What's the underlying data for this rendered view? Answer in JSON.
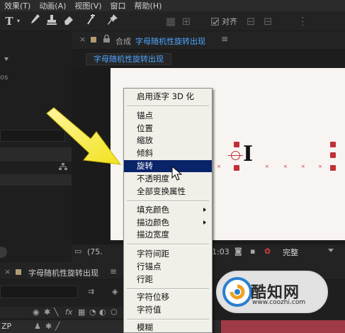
{
  "menubar": {
    "items": [
      "效果(T)",
      "动画(A)",
      "视图(V)",
      "窗口",
      "帮助(H)"
    ]
  },
  "toolbar": {
    "snap_label": "对齐"
  },
  "left_panel": {
    "partial_text": "os"
  },
  "comp_panel": {
    "kind_label": "合成",
    "comp_name": "字母随机性旋转出现",
    "tab_label": "字母随机性旋转出现",
    "zoom": "(75.",
    "timecode": "1:03",
    "resolution": "完整"
  },
  "timeline": {
    "comp_name": "字母随机性旋转出现",
    "layer_label": "ZP"
  },
  "context_menu": {
    "items": [
      {
        "label": "启用逐字 3D 化"
      },
      {
        "label": "锚点"
      },
      {
        "label": "位置"
      },
      {
        "label": "缩放"
      },
      {
        "label": "倾斜"
      },
      {
        "label": "旋转",
        "highlighted": true
      },
      {
        "label": "不透明度"
      },
      {
        "label": "全部变换属性"
      },
      {
        "label": "填充颜色",
        "submenu": true
      },
      {
        "label": "描边颜色",
        "submenu": true
      },
      {
        "label": "描边宽度"
      },
      {
        "label": "字符间距"
      },
      {
        "label": "行锚点"
      },
      {
        "label": "行距"
      },
      {
        "label": "字符位移"
      },
      {
        "label": "字符值"
      },
      {
        "label": "模糊"
      }
    ],
    "highlight_color": "#0a246a"
  },
  "canvas": {
    "letter": "I"
  },
  "watermark": {
    "name": "酷知网",
    "url": "www.coozhi.com"
  },
  "colors": {
    "accent_blue": "#4da6ff",
    "arrow_yellow": "#f2e21c",
    "track_red": "#a03a46",
    "handle_red": "#c03038"
  }
}
